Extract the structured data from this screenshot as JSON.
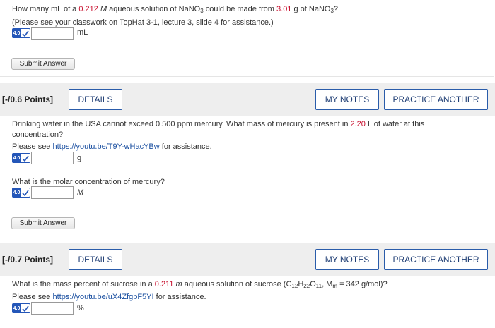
{
  "q_prev": {
    "text_parts": [
      "How many mL of a ",
      "0.212",
      " M",
      " aqueous solution of NaNO",
      "3",
      " could be made from ",
      "3.01",
      " g of NaNO",
      "3",
      "?"
    ],
    "hint": "(Please see your classwork on TopHat 3-1, lecture 3, slide 4 for assistance.)",
    "badge_points": "4.0",
    "input_value": "",
    "unit": "mL",
    "submit_label": "Submit Answer"
  },
  "q_mercury": {
    "points_label": "[-/0.6 Points]",
    "details_label": "DETAILS",
    "my_notes_label": "MY NOTES",
    "practice_label": "PRACTICE ANOTHER",
    "line1_parts": [
      "Drinking water in the USA cannot exceed 0.500 ppm mercury. What mass of mercury is present in ",
      "2.20",
      " L of water at this"
    ],
    "line2": "concentration?",
    "see_prefix": "Please see ",
    "see_link": "https://youtu.be/T9Y-wHacYBw",
    "see_suffix": " for assistance.",
    "badge_points": "4.0",
    "input1_value": "",
    "unit1": "g",
    "part2": "What is the molar concentration of mercury?",
    "input2_value": "",
    "unit2": "M",
    "submit_label": "Submit Answer"
  },
  "q_sucrose": {
    "points_label": "[-/0.7 Points]",
    "details_label": "DETAILS",
    "my_notes_label": "MY NOTES",
    "practice_label": "PRACTICE ANOTHER",
    "text_parts": [
      "What is the mass percent of sucrose in a ",
      "0.211",
      " m",
      " aqueous solution of sucrose (C",
      "12",
      "H",
      "22",
      "O",
      "11",
      ", M",
      "m",
      " = 342 g/mol)?"
    ],
    "see_prefix": "Please see ",
    "see_link": "https://youtu.be/uX4ZfgbF5YI",
    "see_suffix": " for assistance.",
    "badge_points": "4.0",
    "input_value": "",
    "unit": "%"
  },
  "colors": {
    "accent": "#2456b8",
    "highlight": "#c8102e",
    "header_bg": "#eeeeee"
  }
}
